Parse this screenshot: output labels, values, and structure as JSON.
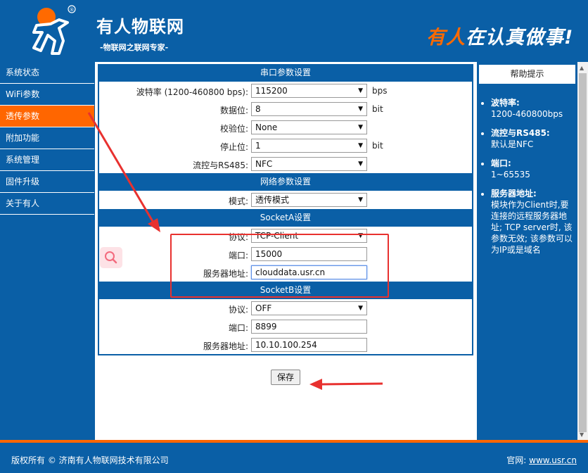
{
  "header": {
    "brand_name": "有人物联网",
    "brand_sub": "-物联网之联网专家-",
    "slogan_a": "有人",
    "slogan_b": "在认真做事!",
    "registered": "®"
  },
  "sidebar": {
    "items": [
      {
        "label": "系统状态"
      },
      {
        "label": "WiFi参数"
      },
      {
        "label": "透传参数"
      },
      {
        "label": "附加功能"
      },
      {
        "label": "系统管理"
      },
      {
        "label": "固件升级"
      },
      {
        "label": "关于有人"
      }
    ],
    "active_index": 2
  },
  "serial": {
    "title": "串口参数设置",
    "baud_label": "波特率 (1200-460800 bps):",
    "baud_value": "115200",
    "baud_unit": "bps",
    "data_label": "数据位:",
    "data_value": "8",
    "data_unit": "bit",
    "parity_label": "校验位:",
    "parity_value": "None",
    "stop_label": "停止位:",
    "stop_value": "1",
    "stop_unit": "bit",
    "flow_label": "流控与RS485:",
    "flow_value": "NFC"
  },
  "network": {
    "title": "网络参数设置",
    "mode_label": "模式:",
    "mode_value": "透传模式"
  },
  "socketA": {
    "title": "SocketA设置",
    "protocol_label": "协议:",
    "protocol_value": "TCP-Client",
    "port_label": "端口:",
    "port_value": "15000",
    "server_label": "服务器地址:",
    "server_value": "clouddata.usr.cn"
  },
  "socketB": {
    "title": "SocketB设置",
    "protocol_label": "协议:",
    "protocol_value": "OFF",
    "port_label": "端口:",
    "port_value": "8899",
    "server_label": "服务器地址:",
    "server_value": "10.10.100.254"
  },
  "save_label": "保存",
  "help": {
    "title": "帮助提示",
    "items": [
      {
        "head": "波特率:",
        "body": "1200-460800bps"
      },
      {
        "head": "流控与RS485:",
        "body": "默认是NFC"
      },
      {
        "head": "端口:",
        "body": "1~65535"
      },
      {
        "head": "服务器地址:",
        "body": "模块作为Client时,要连接的远程服务器地址; TCP server时, 该参数无效; 该参数可以为IP或是域名"
      }
    ]
  },
  "footer": {
    "copyright": "版权所有 © 济南有人物联网技术有限公司",
    "site_label": "官网:",
    "site_url": "www.usr.cn"
  },
  "colors": {
    "primary": "#0a5fa6",
    "accent": "#ff6600",
    "annotation_red": "#e8312f"
  }
}
